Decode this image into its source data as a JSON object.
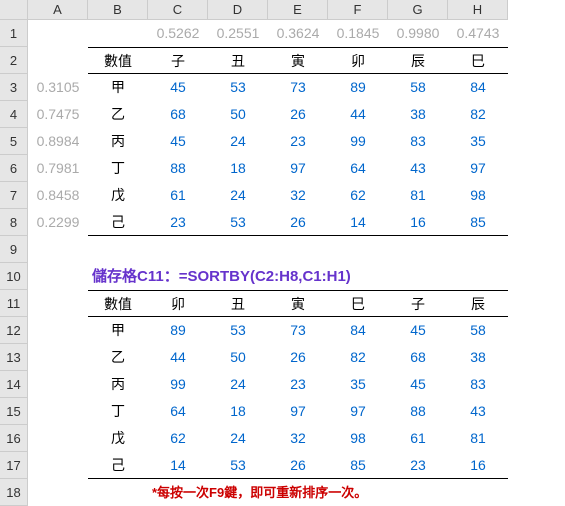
{
  "cols": [
    "A",
    "B",
    "C",
    "D",
    "E",
    "F",
    "G",
    "H"
  ],
  "rows": [
    "1",
    "2",
    "3",
    "4",
    "5",
    "6",
    "7",
    "8",
    "9",
    "10",
    "11",
    "12",
    "13",
    "14",
    "15",
    "16",
    "17",
    "18"
  ],
  "rand_top": [
    "0.5262",
    "0.2551",
    "0.3624",
    "0.1845",
    "0.9980",
    "0.4743"
  ],
  "rand_left": [
    "0.3105",
    "0.7475",
    "0.8984",
    "0.7981",
    "0.8458",
    "0.2299"
  ],
  "t1_hdr_label": "數值",
  "t1_cols": [
    "子",
    "丑",
    "寅",
    "卯",
    "辰",
    "巳"
  ],
  "t1_rows": [
    "甲",
    "乙",
    "丙",
    "丁",
    "戊",
    "己"
  ],
  "t1_data": [
    [
      "45",
      "53",
      "73",
      "89",
      "58",
      "84"
    ],
    [
      "68",
      "50",
      "26",
      "44",
      "38",
      "82"
    ],
    [
      "45",
      "24",
      "23",
      "99",
      "83",
      "35"
    ],
    [
      "88",
      "18",
      "97",
      "64",
      "43",
      "97"
    ],
    [
      "61",
      "24",
      "32",
      "62",
      "81",
      "98"
    ],
    [
      "23",
      "53",
      "26",
      "14",
      "16",
      "85"
    ]
  ],
  "formula_label": "儲存格C11：=SORTBY(C2:H8,C1:H1)",
  "t2_hdr_label": "數值",
  "t2_cols": [
    "卯",
    "丑",
    "寅",
    "巳",
    "子",
    "辰"
  ],
  "t2_rows": [
    "甲",
    "乙",
    "丙",
    "丁",
    "戊",
    "己"
  ],
  "t2_data": [
    [
      "89",
      "53",
      "73",
      "84",
      "45",
      "58"
    ],
    [
      "44",
      "50",
      "26",
      "82",
      "68",
      "38"
    ],
    [
      "99",
      "24",
      "23",
      "35",
      "45",
      "83"
    ],
    [
      "64",
      "18",
      "97",
      "97",
      "88",
      "43"
    ],
    [
      "62",
      "24",
      "32",
      "98",
      "61",
      "81"
    ],
    [
      "14",
      "53",
      "26",
      "85",
      "23",
      "16"
    ]
  ],
  "footer_note": "*每按一次F9鍵，即可重新排序一次。"
}
